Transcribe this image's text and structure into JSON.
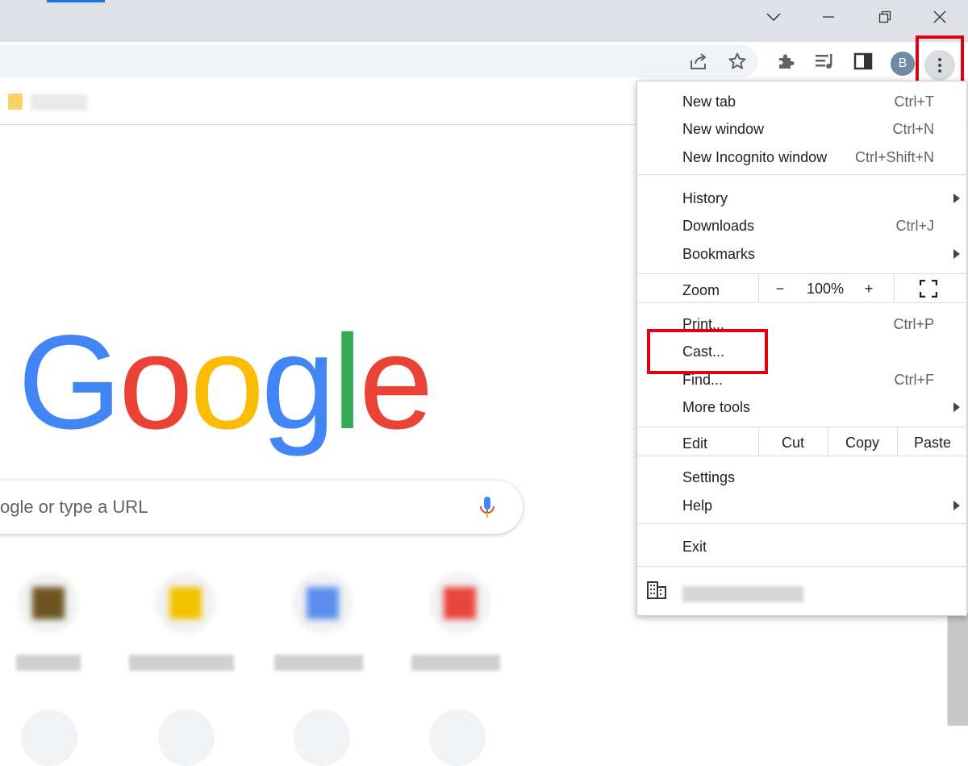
{
  "browser": {
    "profile_initial": "B"
  },
  "icons": {
    "tab_search": "chevron-down-icon",
    "minimize": "minimize-icon",
    "restore": "restore-icon",
    "close": "close-icon",
    "share": "share-icon",
    "bookmark": "star-icon",
    "extensions": "puzzle-icon",
    "media": "playlist-icon",
    "side_panel": "side-panel-icon",
    "menu": "kebab-menu-icon",
    "fullscreen": "fullscreen-icon",
    "managed": "building-icon",
    "voice": "mic-icon",
    "folder": "folder-icon"
  },
  "colors": {
    "highlight": "#e0000f",
    "google_blue": "#4285f4",
    "google_red": "#ea4335",
    "google_yellow": "#fbbc05",
    "google_green": "#34a853"
  },
  "newtab": {
    "logo_letters": [
      "G",
      "o",
      "o",
      "g",
      "l",
      "e"
    ],
    "search_placeholder": "ogle or type a URL"
  },
  "menu": {
    "items": {
      "new_tab": {
        "label": "New tab",
        "shortcut": "Ctrl+T"
      },
      "new_window": {
        "label": "New window",
        "shortcut": "Ctrl+N"
      },
      "new_incognito": {
        "label": "New Incognito window",
        "shortcut": "Ctrl+Shift+N"
      },
      "history": {
        "label": "History"
      },
      "downloads": {
        "label": "Downloads",
        "shortcut": "Ctrl+J"
      },
      "bookmarks": {
        "label": "Bookmarks"
      },
      "print": {
        "label": "Print...",
        "shortcut": "Ctrl+P"
      },
      "cast": {
        "label": "Cast..."
      },
      "find": {
        "label": "Find...",
        "shortcut": "Ctrl+F"
      },
      "more_tools": {
        "label": "More tools"
      },
      "settings": {
        "label": "Settings"
      },
      "help": {
        "label": "Help"
      },
      "exit": {
        "label": "Exit"
      }
    },
    "zoom": {
      "label": "Zoom",
      "minus": "−",
      "value": "100%",
      "plus": "+"
    },
    "edit": {
      "label": "Edit",
      "cut": "Cut",
      "copy": "Copy",
      "paste": "Paste"
    }
  }
}
